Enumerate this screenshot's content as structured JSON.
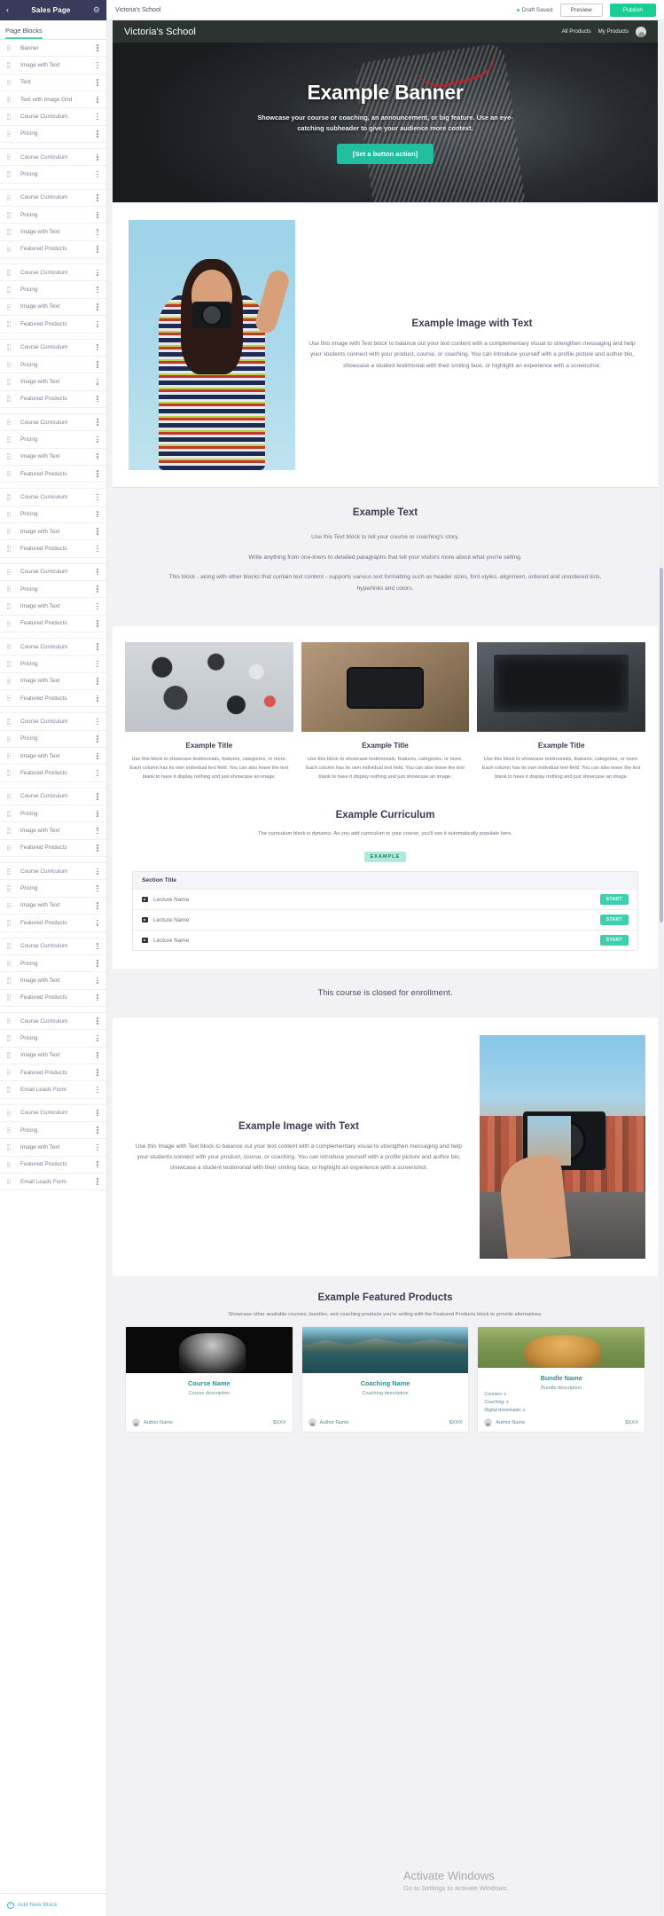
{
  "sidebar": {
    "back_icon": "chevron-left-icon",
    "title": "Sales Page",
    "gear_icon": "gear-icon",
    "tab_label": "Page Blocks",
    "items": [
      {
        "label": "Banner"
      },
      {
        "label": "Image with Text"
      },
      {
        "label": "Text"
      },
      {
        "label": "Text with Image Grid"
      },
      {
        "label": "Course Curriculum"
      },
      {
        "label": "Pricing"
      },
      {
        "sep": true
      },
      {
        "label": "Course Curriculum"
      },
      {
        "label": "Pricing"
      },
      {
        "sep": true
      },
      {
        "label": "Course Curriculum"
      },
      {
        "label": "Pricing"
      },
      {
        "label": "Image with Text"
      },
      {
        "label": "Featured Products"
      },
      {
        "sep": true
      },
      {
        "label": "Course Curriculum"
      },
      {
        "label": "Pricing"
      },
      {
        "label": "Image with Text"
      },
      {
        "label": "Featured Products"
      },
      {
        "sep": true
      },
      {
        "label": "Course Curriculum"
      },
      {
        "label": "Pricing"
      },
      {
        "label": "Image with Text"
      },
      {
        "label": "Featured Products"
      },
      {
        "sep": true
      },
      {
        "label": "Course Curriculum"
      },
      {
        "label": "Pricing"
      },
      {
        "label": "Image with Text"
      },
      {
        "label": "Featured Products"
      },
      {
        "sep": true
      },
      {
        "label": "Course Curriculum"
      },
      {
        "label": "Pricing"
      },
      {
        "label": "Image with Text"
      },
      {
        "label": "Featured Products"
      },
      {
        "sep": true
      },
      {
        "label": "Course Curriculum"
      },
      {
        "label": "Pricing"
      },
      {
        "label": "Image with Text"
      },
      {
        "label": "Featured Products"
      },
      {
        "sep": true
      },
      {
        "label": "Course Curriculum"
      },
      {
        "label": "Pricing"
      },
      {
        "label": "Image with Text"
      },
      {
        "label": "Featured Products"
      },
      {
        "sep": true
      },
      {
        "label": "Course Curriculum"
      },
      {
        "label": "Pricing"
      },
      {
        "label": "Image with Text"
      },
      {
        "label": "Featured Products"
      },
      {
        "sep": true
      },
      {
        "label": "Course Curriculum"
      },
      {
        "label": "Pricing"
      },
      {
        "label": "Image with Text"
      },
      {
        "label": "Featured Products"
      },
      {
        "sep": true
      },
      {
        "label": "Course Curriculum"
      },
      {
        "label": "Pricing"
      },
      {
        "label": "Image with Text"
      },
      {
        "label": "Featured Products"
      },
      {
        "sep": true
      },
      {
        "label": "Course Curriculum"
      },
      {
        "label": "Pricing"
      },
      {
        "label": "Image with Text"
      },
      {
        "label": "Featured Products"
      },
      {
        "sep": true
      },
      {
        "label": "Course Curriculum"
      },
      {
        "label": "Pricing"
      },
      {
        "label": "Image with Text"
      },
      {
        "label": "Featured Products"
      },
      {
        "label": "Email Leads Form"
      },
      {
        "sep": true
      },
      {
        "label": "Course Curriculum"
      },
      {
        "label": "Pricing"
      },
      {
        "label": "Image with Text"
      },
      {
        "label": "Featured Products"
      },
      {
        "label": "Email Leads Form"
      }
    ],
    "add_block_label": "Add New Block",
    "add_icon": "plus-circle-icon"
  },
  "topbar": {
    "school_name": "Victoria's School",
    "draft_status": "Draft Saved",
    "preview_label": "Preview",
    "publish_label": "Publish",
    "accent_color": "#19cd95"
  },
  "site_header": {
    "brand": "Victoria's School",
    "nav": [
      "All Products",
      "My Products"
    ],
    "avatar_icon": "user-avatar-icon"
  },
  "banner": {
    "heading": "Example Banner",
    "subheading": "Showcase your course or coaching, an announcement, or big feature. Use an eye-catching subheader to give your audience more context.",
    "button_label": "[Set a button action]",
    "button_color": "#21bfa0"
  },
  "image_with_text_1": {
    "heading": "Example Image with Text",
    "body": "Use this Image with Text block to balance out your text content with a complementary visual to strengthen messaging and help your students connect with your product, course, or coaching. You can introduce yourself with a profile picture and author bio, showcase a student testimonial with their smiling face, or highlight an experience with a screenshot.",
    "image_alt": "woman-with-camera-photo"
  },
  "text_block": {
    "heading": "Example Text",
    "paragraphs": [
      "Use this Text block to tell your course or coaching's story.",
      "Write anything from one-liners to detailed paragraphs that tell your visitors more about what you're selling.",
      "This block - along with other blocks that contain text content - supports various text formatting such as header sizes, font styles, alignment, ordered and unordered lists, hyperlinks and colors."
    ]
  },
  "image_grid": {
    "items": [
      {
        "title": "Example Title",
        "body": "Use this block to showcase testimonials, features, categories, or more. Each column has its own individual text field. You can also leave the text blank to have it display nothing and just showcase an image.",
        "image_alt": "camera-gear-flatlay-photo"
      },
      {
        "title": "Example Title",
        "body": "Use this block to showcase testimonials, features, categories, or more. Each column has its own individual text field. You can also leave the text blank to have it display nothing and just showcase an image.",
        "image_alt": "camera-on-desk-photo"
      },
      {
        "title": "Example Title",
        "body": "Use this block to showcase testimonials, features, categories, or more. Each column has its own individual text field. You can also leave the text blank to have it display nothing and just showcase an image.",
        "image_alt": "tablet-editing-photo"
      }
    ]
  },
  "curriculum": {
    "heading": "Example Curriculum",
    "subtext": "The curriculum block is dynamic. As you add curriculum to your course, you'll see it automatically populate here.",
    "badge": "EXAMPLE",
    "section_title": "Section Title",
    "lectures": [
      {
        "name": "Lecture Name",
        "action": "START",
        "icon": "video-play-icon"
      },
      {
        "name": "Lecture Name",
        "action": "START",
        "icon": "video-play-icon"
      },
      {
        "name": "Lecture Name",
        "action": "START",
        "icon": "video-play-icon"
      }
    ]
  },
  "pricing": {
    "closed_message": "This course is closed for enrollment."
  },
  "image_with_text_2": {
    "heading": "Example Image with Text",
    "body": "Use this Image with Text block to balance out your text content with a complementary visual to strengthen messaging and help your students connect with your product, course, or coaching. You can introduce yourself with a profile picture and author bio, showcase a student testimonial with their smiling face, or highlight an experience with a screenshot.",
    "image_alt": "hand-holding-camera-city-photo"
  },
  "featured_products": {
    "heading": "Example Featured Products",
    "subtext": "Showcase other available courses, bundles, and coaching products you're selling with the Featured Products block to provide alternatives.",
    "cards": [
      {
        "title": "Course Name",
        "description": "Course description",
        "author": "Author Name",
        "price": "$XXX",
        "meta": [],
        "image_alt": "portrait-bw-photo"
      },
      {
        "title": "Coaching Name",
        "description": "Coaching description",
        "author": "Author Name",
        "price": "$XXX",
        "meta": [],
        "image_alt": "mountain-lake-photo"
      },
      {
        "title": "Bundle Name",
        "description": "Bundle description",
        "author": "Author Name",
        "price": "$XXX",
        "meta": [
          "Courses: x",
          "Coaching: x",
          "Digital downloads: x"
        ],
        "image_alt": "golden-retriever-photo"
      }
    ]
  },
  "watermark": {
    "line1": "Activate Windows",
    "line2": "Go to Settings to activate Windows."
  }
}
